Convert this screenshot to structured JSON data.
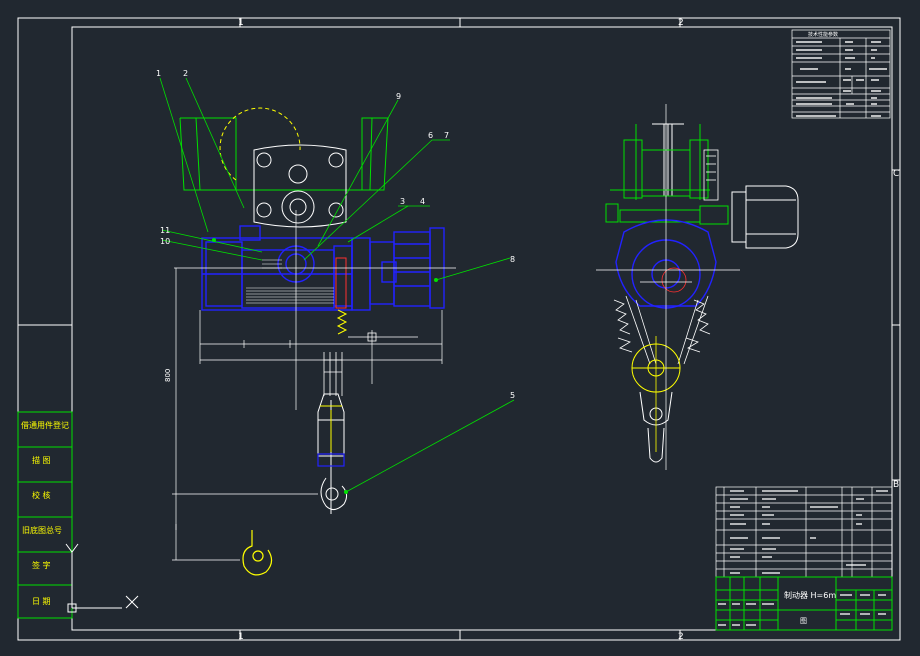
{
  "colors": {
    "background": "#212830",
    "frame": "#ffffff",
    "green": "#00e000",
    "blue": "#2222ff",
    "yellow": "#ffff00",
    "red": "#ff3030",
    "cyan": "#00e0e0",
    "white": "#ffffff"
  },
  "zones": {
    "top_1": "1",
    "top_2": "2",
    "bottom_1": "1",
    "bottom_2": "2",
    "right_c": "C",
    "right_b": "B"
  },
  "balloons": [
    "1",
    "2",
    "9",
    "6",
    "7",
    "3",
    "4",
    "11",
    "10",
    "8",
    "5"
  ],
  "dimension_text": "800",
  "left_table": [
    "借通用件登记",
    "描 图",
    "校 核",
    "旧底图总号",
    "签 字",
    "日 期"
  ],
  "title_block": {
    "drawing_name": "制动器 H=6m",
    "scale_cell": "图"
  },
  "spec_table": {
    "header": "技术性能参数"
  }
}
